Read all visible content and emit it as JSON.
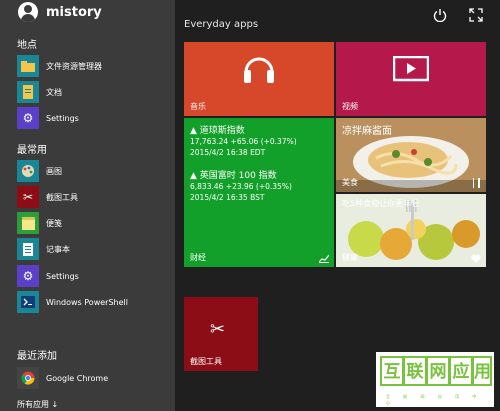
{
  "user": {
    "name": "mistory"
  },
  "section_places": "地点",
  "places": [
    {
      "label": "文件资源管理器",
      "icon": "folder-icon",
      "color": "#1b8796"
    },
    {
      "label": "文档",
      "icon": "document-icon",
      "color": "#1b8796"
    },
    {
      "label": "Settings",
      "icon": "gear-icon",
      "color": "#5a3fc7"
    }
  ],
  "section_frequent": "最常用",
  "frequent": [
    {
      "label": "画图",
      "icon": "palette-icon",
      "color": "#1b8796"
    },
    {
      "label": "截图工具",
      "icon": "scissors-icon",
      "color": "#8c0d16"
    },
    {
      "label": "便笺",
      "icon": "note-icon",
      "color": "#2e9e3d"
    },
    {
      "label": "记事本",
      "icon": "notepad-icon",
      "color": "#1b8796"
    },
    {
      "label": "Settings",
      "icon": "gear-icon",
      "color": "#5a3fc7"
    },
    {
      "label": "Windows PowerShell",
      "icon": "terminal-icon",
      "color": "#1b8796"
    }
  ],
  "section_recent": "最近添加",
  "recent": [
    {
      "label": "Google Chrome",
      "icon": "chrome-icon",
      "color": "#444444"
    }
  ],
  "all_apps": "所有应用 ↓",
  "tiles_title": "Everyday apps",
  "tiles": {
    "music": {
      "label": "音乐",
      "color": "#d7472a"
    },
    "video": {
      "label": "视频",
      "color": "#b5184a"
    },
    "finance": {
      "label": "财经",
      "color": "#13a02a",
      "row1_title": "▲ 道琼斯指数",
      "row1_value": "17,763.24 +65.06 (+0.37%)",
      "row1_time": "2015/4/2 16:38 EDT",
      "row2_title": "▲ 英国富时 100 指数",
      "row2_value": "6,833.46 +23.96 (+0.35%)",
      "row2_time": "2015/4/2 16:35 BST"
    },
    "food": {
      "label": "美食",
      "headline": "凉拌麻酱面",
      "color": "#c8a36e"
    },
    "health": {
      "label": "健康",
      "headline": "吃5种食物让你更年轻",
      "color": "#c5d26e"
    },
    "snipping": {
      "label": "截图工具",
      "color": "#8c0d16"
    }
  },
  "watermark": {
    "chars": [
      "互",
      "联",
      "网",
      "应",
      "用"
    ],
    "small": "互 联 网 应 用 中 心"
  }
}
